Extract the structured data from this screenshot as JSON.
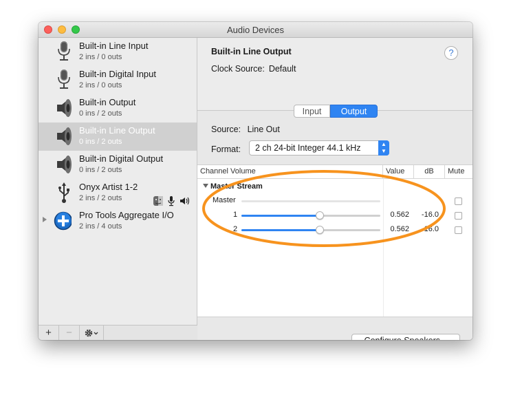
{
  "window": {
    "title": "Audio Devices"
  },
  "devices": [
    {
      "name": "Built-in Line Input",
      "io": "2 ins / 0 outs",
      "icon": "microphone-icon"
    },
    {
      "name": "Built-in Digital Input",
      "io": "2 ins / 0 outs",
      "icon": "microphone-icon"
    },
    {
      "name": "Built-in Output",
      "io": "0 ins / 2 outs",
      "icon": "speaker-icon"
    },
    {
      "name": "Built-in Line Output",
      "io": "0 ins / 2 outs",
      "icon": "speaker-icon",
      "selected": true
    },
    {
      "name": "Built-in Digital Output",
      "io": "0 ins / 2 outs",
      "icon": "speaker-icon"
    },
    {
      "name": "Onyx Artist 1-2",
      "io": "2 ins / 2 outs",
      "icon": "usb-icon"
    },
    {
      "name": "Pro Tools Aggregate I/O",
      "io": "2 ins / 4 outs",
      "icon": "aggregate-plus-icon"
    }
  ],
  "sidebar_buttons": {
    "add": "+",
    "remove": "−",
    "gear": "gear-icon"
  },
  "detail": {
    "title": "Built-in Line Output",
    "clock_label": "Clock Source:",
    "clock_value": "Default",
    "help": "?",
    "tabs": {
      "input": "Input",
      "output": "Output",
      "active": "Output"
    },
    "source_label": "Source:",
    "source_value": "Line Out",
    "format_label": "Format:",
    "format_value": "2 ch 24-bit Integer 44.1 kHz",
    "columns": {
      "channel": "Channel Volume",
      "value": "Value",
      "db": "dB",
      "mute": "Mute"
    },
    "stream": "Master Stream",
    "master_label": "Master",
    "channels": [
      {
        "label": "1",
        "value": "0.562",
        "db": "-16.0",
        "level": 0.562
      },
      {
        "label": "2",
        "value": "0.562",
        "db": "-16.0",
        "level": 0.562
      }
    ],
    "configure_button": "Configure Speakers..."
  },
  "colors": {
    "accent": "#2f84f2",
    "highlight": "#f7931e"
  }
}
